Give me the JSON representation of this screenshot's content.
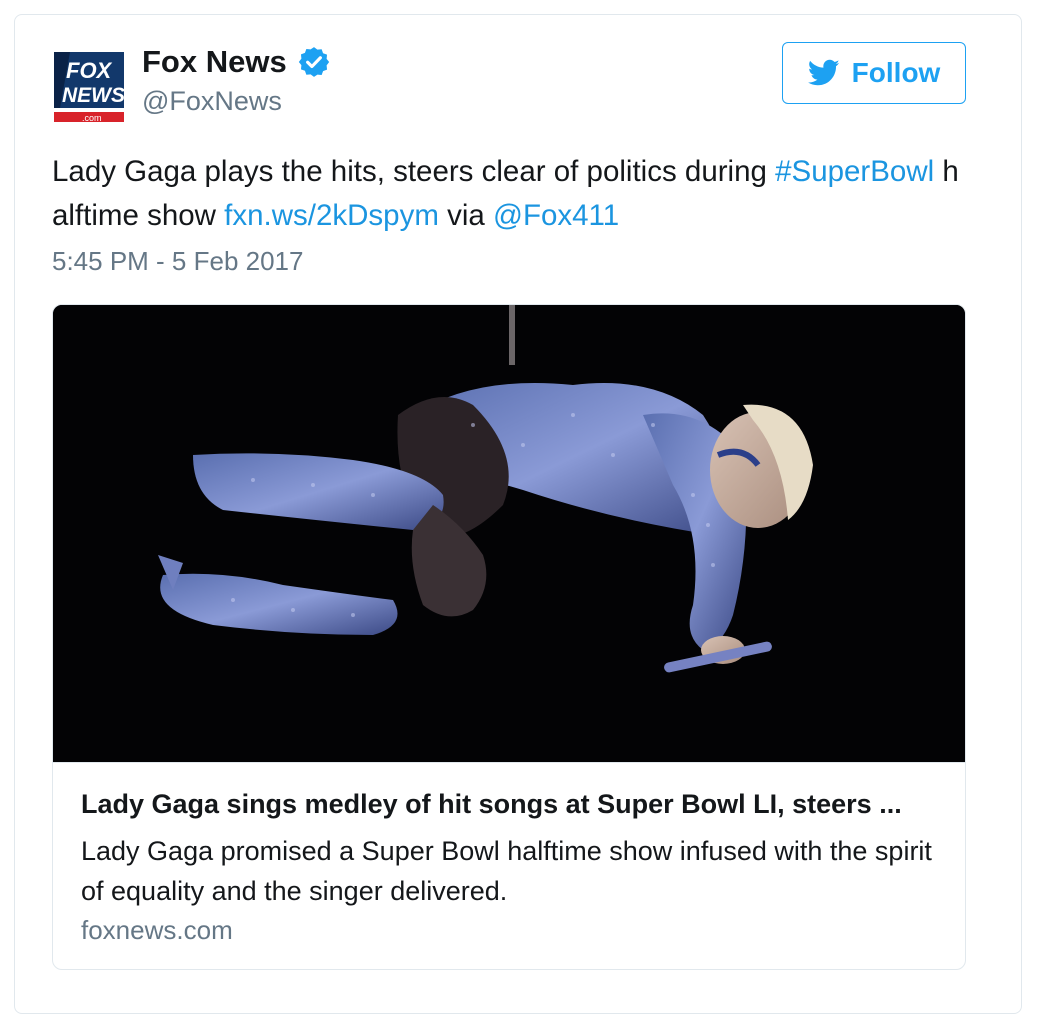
{
  "author": {
    "logo_text_line1": "FOX",
    "logo_text_line2": "NEWS",
    "logo_text_line3": ".com",
    "name": "Fox News",
    "handle": "@FoxNews",
    "verified_icon": "verified-badge-icon"
  },
  "follow_button": {
    "label": "Follow",
    "icon": "twitter-bird-icon"
  },
  "tweet": {
    "text_part1": "Lady Gaga plays the hits, steers clear of politics during ",
    "hashtag": "#SuperBowl",
    "text_part2": " halftime show ",
    "link": "fxn.ws/2kDspym",
    "text_part3": " via ",
    "mention": "@Fox411",
    "timestamp": "5:45 PM - 5 Feb 2017"
  },
  "link_card": {
    "title": "Lady Gaga sings medley of hit songs at Super Bowl LI, steers ...",
    "description": "Lady Gaga promised a Super Bowl halftime show infused with the spirit of equality and the singer delivered.",
    "domain": "foxnews.com"
  },
  "colors": {
    "accent": "#1da1f2",
    "link": "#1b95e0",
    "muted": "#657786",
    "fox_blue": "#12386b",
    "fox_red": "#d8232a"
  }
}
